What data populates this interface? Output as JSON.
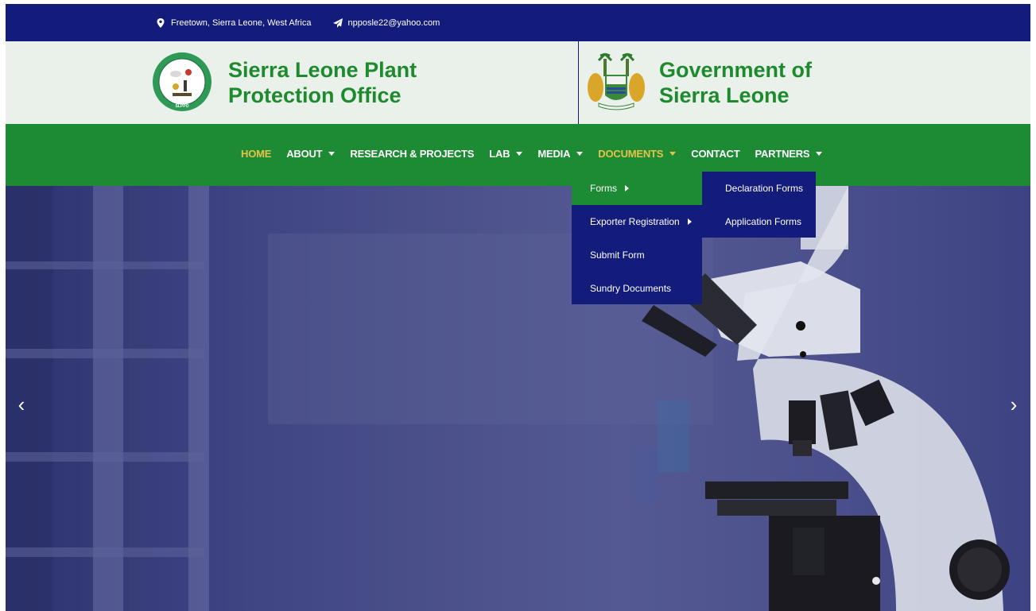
{
  "topbar": {
    "location": "Freetown, Sierra Leone, West Africa",
    "email": "npposle22@yahoo.com",
    "location_icon": "map-marker-icon",
    "email_icon": "paper-plane-icon"
  },
  "header": {
    "org_title_line1": "Sierra Leone Plant",
    "org_title_line2": "Protection Office",
    "gov_title_line1": "Government of",
    "gov_title_line2": "Sierra Leone",
    "org_logo_text": "SLPPO"
  },
  "nav": {
    "items": [
      {
        "label": "HOME",
        "active": true
      },
      {
        "label": "ABOUT"
      },
      {
        "label": "RESEARCH & PROJECTS"
      },
      {
        "label": "LAB"
      },
      {
        "label": "MEDIA"
      },
      {
        "label": "DOCUMENTS",
        "active": true
      },
      {
        "label": "CONTACT"
      },
      {
        "label": "PARTNERS"
      }
    ]
  },
  "documents_menu": {
    "items": [
      {
        "label": "Forms"
      },
      {
        "label": "Exporter Registration"
      },
      {
        "label": "Submit Form"
      },
      {
        "label": "Sundry Documents"
      }
    ]
  },
  "forms_submenu": {
    "items": [
      {
        "label": "Declaration Forms"
      },
      {
        "label": "Application Forms"
      }
    ]
  },
  "hero": {
    "prev": "‹",
    "next": "›"
  },
  "colors": {
    "navy": "#131c7a",
    "green": "#1d8a34",
    "gold": "#e6c24a",
    "header_bg": "#eaf0ea"
  }
}
